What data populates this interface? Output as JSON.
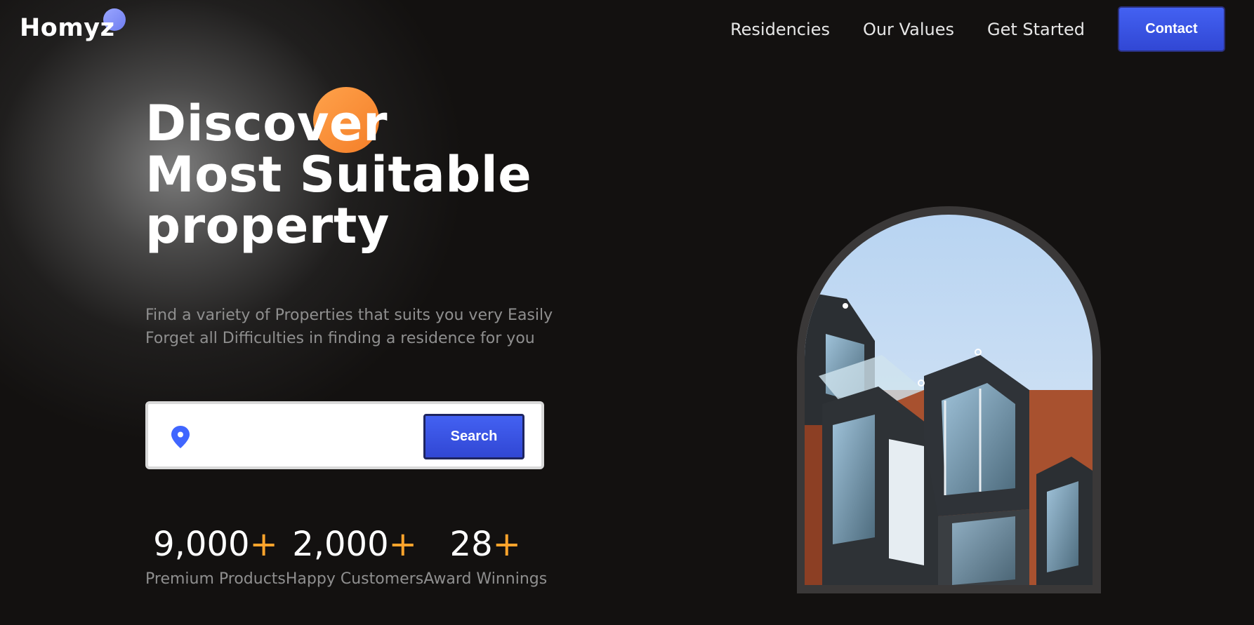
{
  "brand": {
    "name": "Homyz"
  },
  "nav": {
    "links": [
      "Residencies",
      "Our Values",
      "Get Started"
    ],
    "contact_label": "Contact"
  },
  "hero": {
    "title_lines": [
      "Discover",
      "Most Suitable",
      "property"
    ],
    "description_lines": [
      "Find a variety of Properties that suits you very Easily",
      "Forget all Difficulties in finding a residence for you"
    ],
    "search": {
      "value": "",
      "button_label": "Search",
      "icon": "location-pin-icon"
    },
    "stats": [
      {
        "value": "9,000",
        "suffix": "+",
        "label": "Premium Products"
      },
      {
        "value": "2,000",
        "suffix": "+",
        "label": "Happy Customers"
      },
      {
        "value": "28",
        "suffix": "+",
        "label": "Award Winnings"
      }
    ],
    "image_alt": "modern apartment building"
  },
  "colors": {
    "background": "#131110",
    "accent_blue": "#4066ff",
    "accent_orange": "#ffa42c",
    "text_muted": "#8f8f8f"
  }
}
